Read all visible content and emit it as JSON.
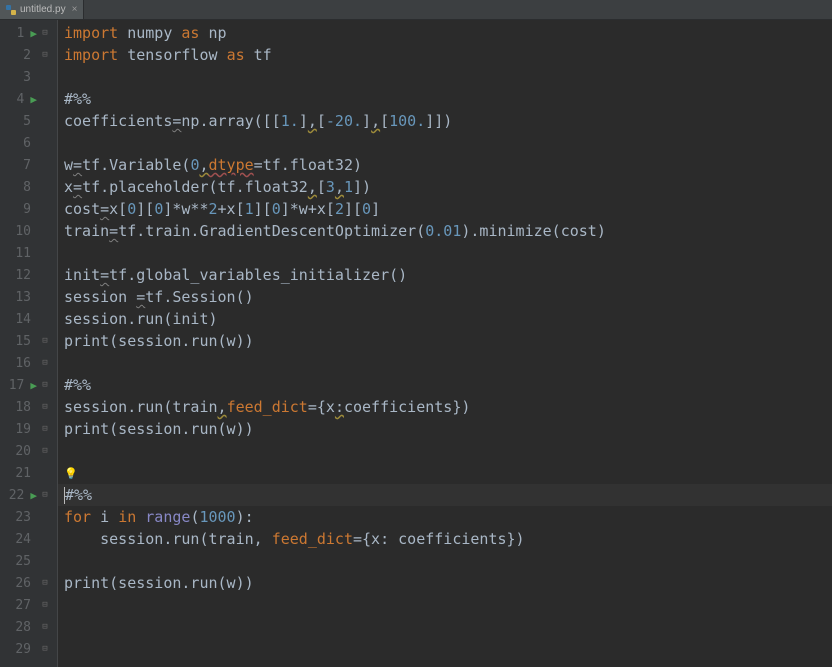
{
  "tab": {
    "filename": "untitled.py",
    "close": "×"
  },
  "gutter": {
    "lines": [
      "1",
      "2",
      "3",
      "4",
      "5",
      "6",
      "7",
      "8",
      "9",
      "10",
      "11",
      "12",
      "13",
      "14",
      "15",
      "16",
      "17",
      "18",
      "19",
      "20",
      "21",
      "22",
      "23",
      "24",
      "25",
      "26",
      "27",
      "28",
      "29"
    ],
    "run_markers": [
      1,
      4,
      17,
      22
    ],
    "fold_open": [
      1,
      15,
      17,
      19,
      22,
      26,
      28
    ],
    "fold_close": [
      2,
      16,
      18,
      20,
      27,
      29
    ]
  },
  "code": {
    "l1": {
      "kw1": "import",
      "sp1": " ",
      "id1": "numpy",
      "sp2": " ",
      "kw2": "as",
      "sp3": " ",
      "id2": "np"
    },
    "l2": {
      "kw1": "import",
      "sp1": " ",
      "id1": "tensorflow",
      "sp2": " ",
      "kw2": "as",
      "sp3": " ",
      "id2": "tf"
    },
    "l3": {
      "text": ""
    },
    "l4": {
      "text": "#%%"
    },
    "l5": {
      "a": "coefficients",
      "eq": "=",
      "b": "np.array([[",
      "n1": "1.",
      "c": "]",
      "com1": ",",
      "d": "[",
      "n2": "-20.",
      "e": "]",
      "com2": ",",
      "f": "[",
      "n3": "100.",
      "g": "]])"
    },
    "l6": {
      "text": ""
    },
    "l7": {
      "a": "w",
      "eq": "=",
      "b": "tf.Variable(",
      "n1": "0",
      "com": ",",
      "kw": "dtype",
      "eq2": "=",
      "c": "tf.float32)"
    },
    "l8": {
      "a": "x",
      "eq": "=",
      "b": "tf.placeholder(tf.float32",
      "com": ",",
      "c": "[",
      "n1": "3",
      "com2": ",",
      "n2": "1",
      "d": "])"
    },
    "l9": {
      "a": "cost",
      "eq": "=",
      "b": "x[",
      "n1": "0",
      "c": "][",
      "n2": "0",
      "d": "]*w**",
      "n3": "2",
      "e": "+x[",
      "n4": "1",
      "f": "][",
      "n5": "0",
      "g": "]*w+x[",
      "n6": "2",
      "h": "][",
      "n7": "0",
      "i": "]"
    },
    "l10": {
      "a": "train",
      "eq": "=",
      "b": "tf.train.GradientDescentOptimizer(",
      "n1": "0.01",
      "c": ").minimize(cost)"
    },
    "l11": {
      "text": ""
    },
    "l12": {
      "a": "init",
      "eq": "=",
      "b": "tf.global_variables_initializer()"
    },
    "l13": {
      "a": "session ",
      "eq": "=",
      "b": "tf.Session()"
    },
    "l14": {
      "a": "session.run(init)"
    },
    "l15": {
      "p": "print",
      "a": "(session.run(w))"
    },
    "l16": {
      "text": ""
    },
    "l17": {
      "text": "#%%"
    },
    "l18": {
      "a": "session.run(train",
      "com": ",",
      "kw": "feed_dict",
      "eq": "=",
      "b": "{x",
      "col": ":",
      "c": "coefficients})"
    },
    "l19": {
      "p": "print",
      "a": "(session.run(w))"
    },
    "l20": {
      "text": ""
    },
    "l21": {
      "text": ""
    },
    "l22": {
      "text": "#%%"
    },
    "l23": {
      "kw1": "for",
      "a": " i ",
      "kw2": "in",
      "b": " ",
      "fn": "range",
      "c": "(",
      "n": "1000",
      "d": "):"
    },
    "l24": {
      "a": "    session.run(train, ",
      "kw": "feed_dict",
      "eq": "=",
      "b": "{x: coefficients})"
    },
    "l25": {
      "text": ""
    },
    "l26": {
      "p": "print",
      "a": "(session.run(w))"
    },
    "l27": {
      "text": ""
    },
    "l28": {
      "text": ""
    }
  },
  "icons": {
    "run": "▶",
    "fold_open": "⊟",
    "fold_close": "⊟",
    "bulb": "💡"
  }
}
